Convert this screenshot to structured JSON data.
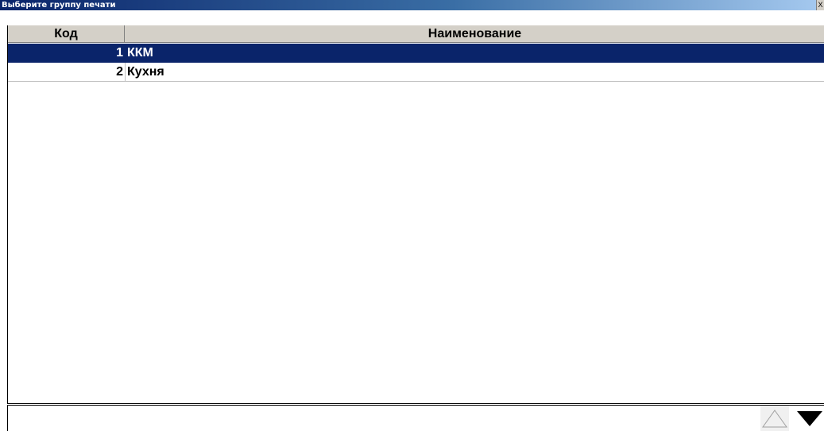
{
  "window": {
    "title": "Выберите группу печати",
    "close_label": "X"
  },
  "table": {
    "columns": [
      "Код",
      "Наименование"
    ],
    "rows": [
      {
        "code": "1",
        "name": "ККМ",
        "selected": true
      },
      {
        "code": "2",
        "name": "Кухня",
        "selected": false
      }
    ]
  },
  "controls": {
    "scroll_up_icon": "triangle-up-icon",
    "scroll_down_icon": "triangle-down-icon"
  },
  "colors": {
    "selection": "#0a246a",
    "header_bg": "#d4d0c8"
  }
}
